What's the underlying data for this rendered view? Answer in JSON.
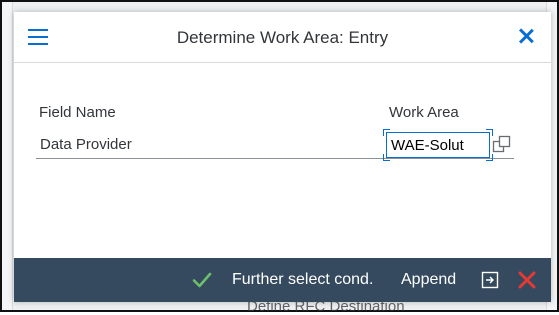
{
  "dialog": {
    "title": "Determine Work Area: Entry"
  },
  "table": {
    "headers": [
      "Field Name",
      "Work Area"
    ],
    "rows": [
      {
        "field_name": "Data Provider",
        "work_area_value": "WAE-Solut"
      }
    ]
  },
  "footer": {
    "further_select": "Further select cond.",
    "append": "Append"
  },
  "background": {
    "partial_text": "Define RFC Destination"
  },
  "colors": {
    "accent": "#0a6ed1",
    "footer_bg": "#354a5f",
    "confirm_green": "#2b7d2b",
    "cancel_red": "#e52929"
  },
  "icons": {
    "menu": "hamburger-menu-icon",
    "close": "close-icon",
    "value_help": "value-help-icon",
    "confirm": "checkmark-icon",
    "transfer": "transfer-icon",
    "cancel": "cancel-icon"
  }
}
